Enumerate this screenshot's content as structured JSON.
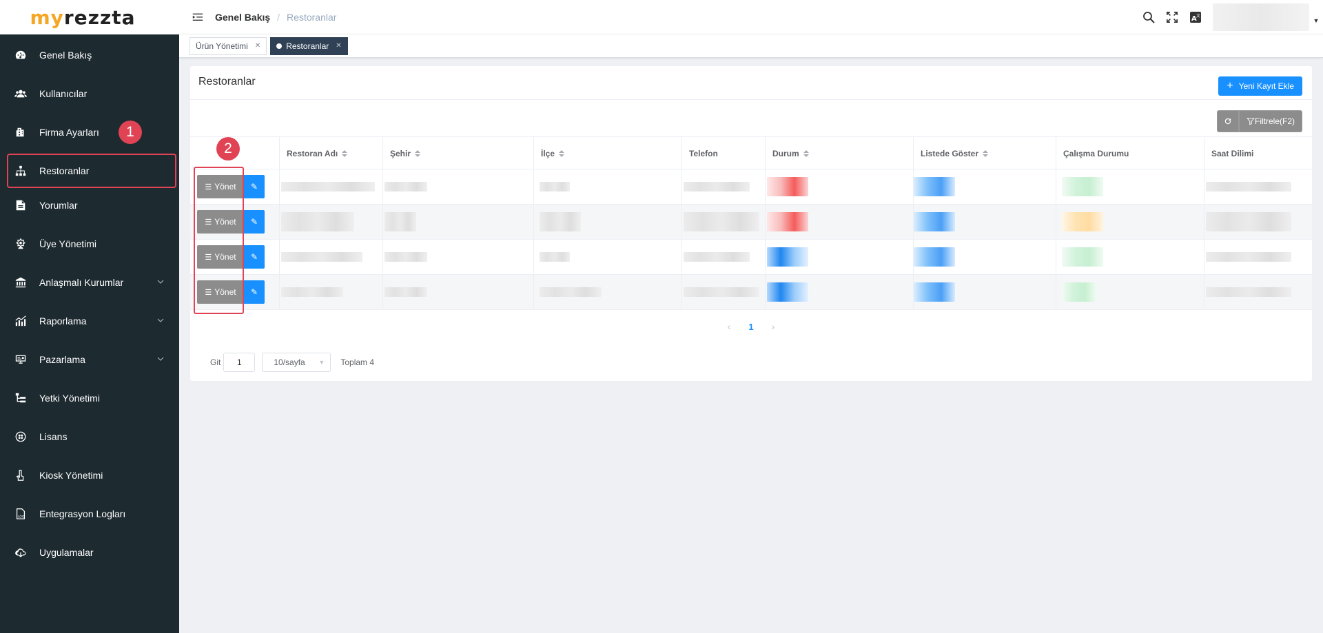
{
  "logo": {
    "part1": "my",
    "part2": "rezzta"
  },
  "sidebar": {
    "items": [
      {
        "label": "Genel Bakış",
        "icon": "dashboard-icon"
      },
      {
        "label": "Kullanıcılar",
        "icon": "users-icon"
      },
      {
        "label": "Firma Ayarları",
        "icon": "building-icon"
      },
      {
        "label": "Restoranlar",
        "icon": "sitemap-icon"
      },
      {
        "label": "Yorumlar",
        "icon": "document-icon"
      },
      {
        "label": "Üye Yönetimi",
        "icon": "member-icon"
      },
      {
        "label": "Anlaşmalı Kurumlar",
        "icon": "bank-icon"
      },
      {
        "label": "Raporlama",
        "icon": "chart-icon"
      },
      {
        "label": "Pazarlama",
        "icon": "marketing-icon"
      },
      {
        "label": "Yetki Yönetimi",
        "icon": "hierarchy-icon"
      },
      {
        "label": "Lisans",
        "icon": "license-icon"
      },
      {
        "label": "Kiosk Yönetimi",
        "icon": "kiosk-icon"
      },
      {
        "label": "Entegrasyon Logları",
        "icon": "log-icon"
      },
      {
        "label": "Uygulamalar",
        "icon": "cloud-icon"
      }
    ]
  },
  "annotations": {
    "badge1": "1",
    "badge2": "2"
  },
  "header": {
    "crumb_home": "Genel Bakış",
    "crumb_sep": "/",
    "crumb_current": "Restoranlar"
  },
  "tags": [
    {
      "label": "Ürün Yönetimi",
      "active": false
    },
    {
      "label": "Restoranlar",
      "active": true
    }
  ],
  "card": {
    "title": "Restoranlar",
    "new_button": "Yeni Kayıt Ekle",
    "filter_button": "Filtrele(F2)"
  },
  "table": {
    "columns": [
      "",
      "Restoran Adı",
      "Şehir",
      "İlçe",
      "Telefon",
      "Durum",
      "Listede Göster",
      "Çalışma Durumu",
      "Saat Dilimi"
    ],
    "row_action_label": "Yönet",
    "rows_count_visible": 4
  },
  "pagination": {
    "current_page": "1",
    "goto_label": "Git",
    "goto_value": "1",
    "page_size": "10/sayfa",
    "total": "Toplam 4"
  },
  "colors": {
    "sidebar_bg": "#1d2a30",
    "accent": "#1890ff",
    "highlight": "#e04454",
    "tag_active": "#304156"
  }
}
